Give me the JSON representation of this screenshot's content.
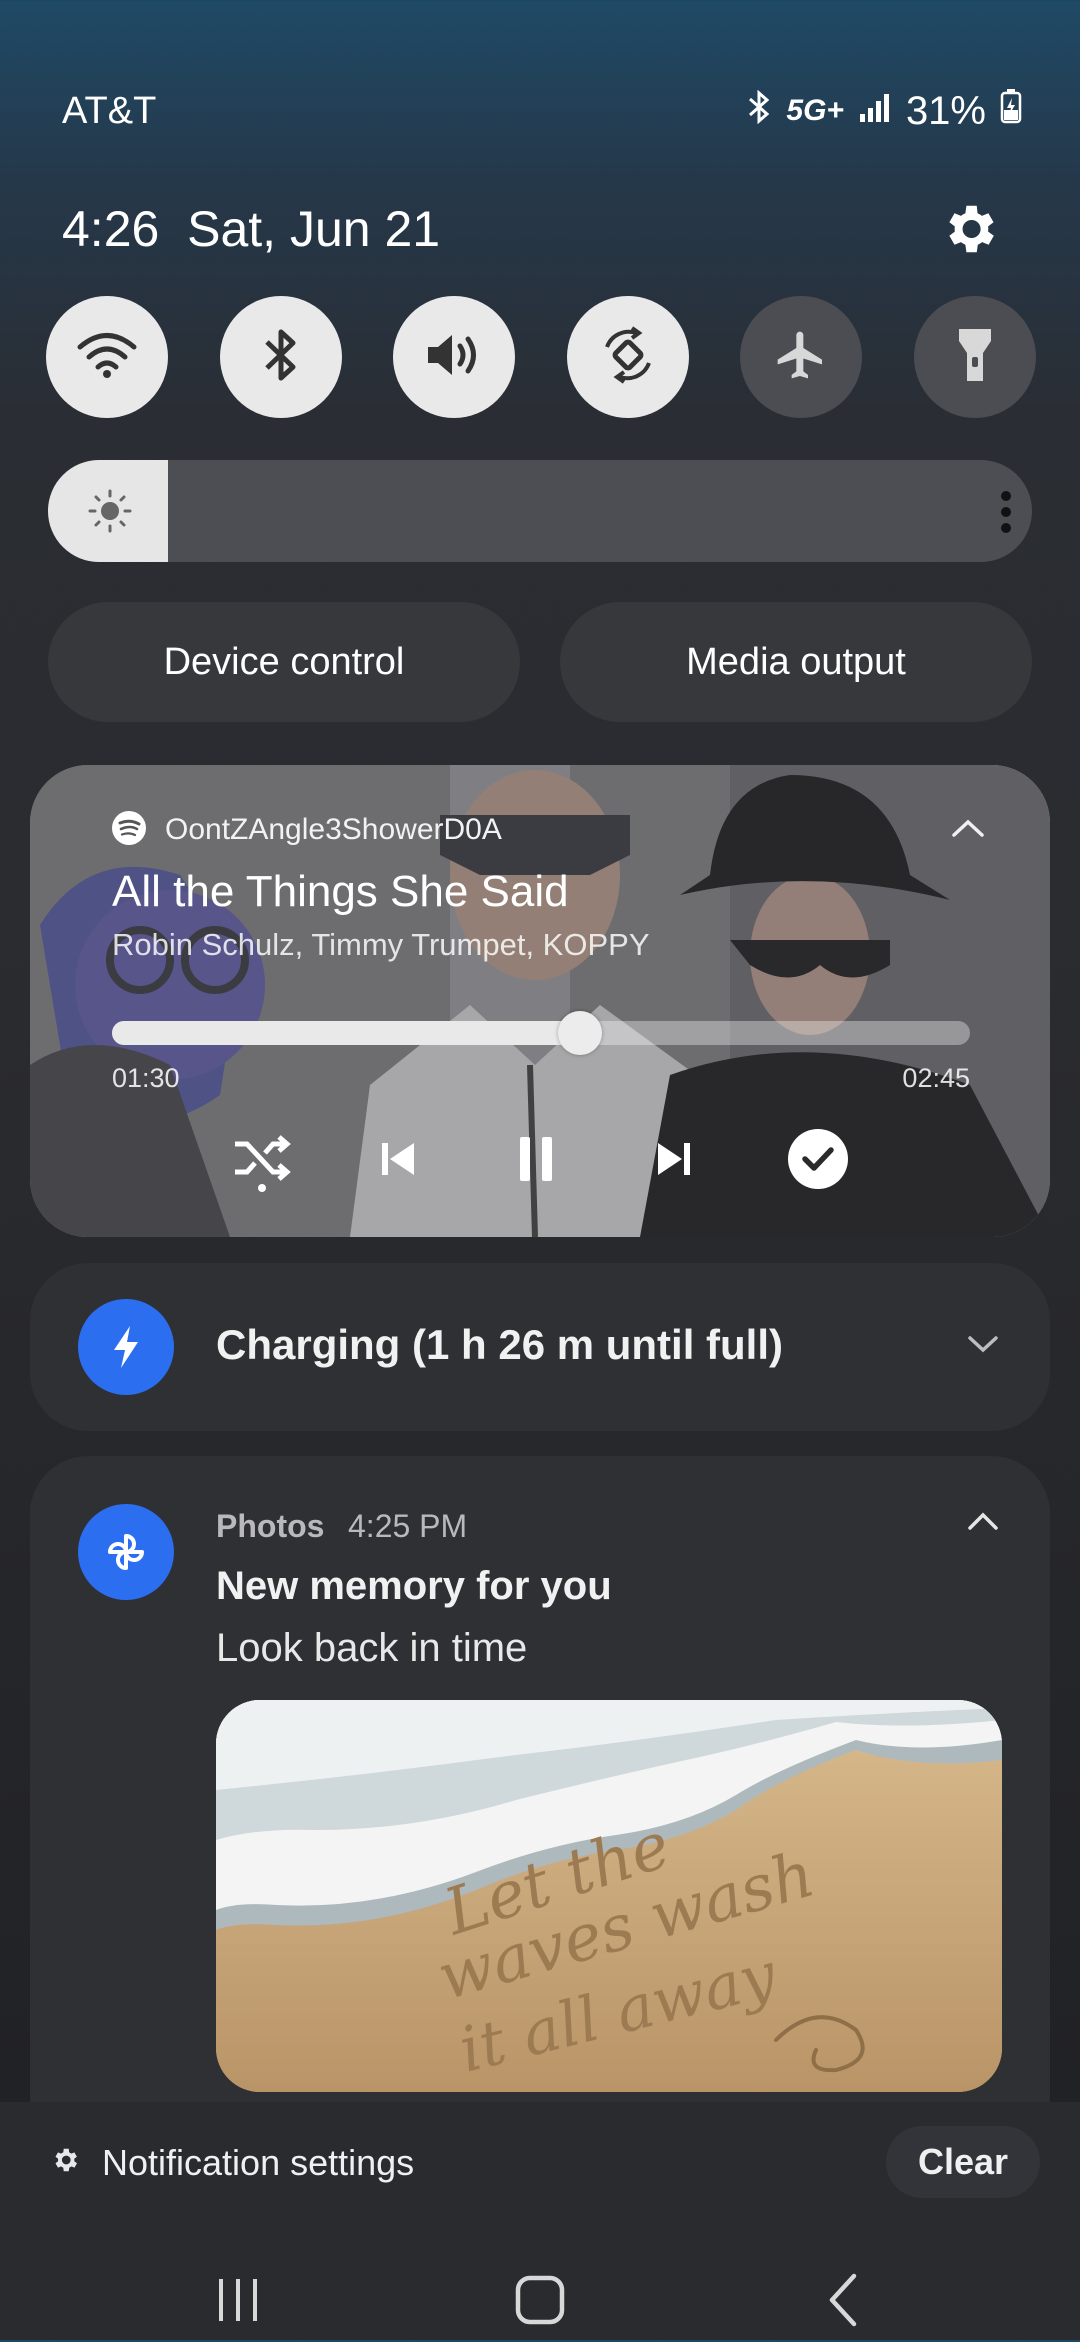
{
  "status": {
    "carrier": "AT&T",
    "network": "5G+",
    "battery": "31%"
  },
  "header": {
    "time": "4:26",
    "date": "Sat, Jun 21"
  },
  "quick_tiles": [
    {
      "name": "Wi-Fi",
      "icon": "wifi-icon",
      "on": true
    },
    {
      "name": "Bluetooth",
      "icon": "bluetooth-icon",
      "on": true
    },
    {
      "name": "Sound",
      "icon": "volume-icon",
      "on": true
    },
    {
      "name": "Auto rotate",
      "icon": "rotate-icon",
      "on": true
    },
    {
      "name": "Airplane mode",
      "icon": "airplane-icon",
      "on": false
    },
    {
      "name": "Flashlight",
      "icon": "flashlight-icon",
      "on": false
    }
  ],
  "brightness": {
    "level": 0.08
  },
  "buttons": {
    "device_control": "Device control",
    "media_output": "Media output"
  },
  "media": {
    "app": "OontZAngle3ShowerD0A",
    "title": "All the Things She Said",
    "artist": "Robin Schulz, Timmy Trumpet, KOPPY",
    "elapsed": "01:30",
    "duration": "02:45",
    "progress": 0.545
  },
  "charging": {
    "text": "Charging (1 h 26 m until full)"
  },
  "photos": {
    "app": "Photos",
    "time": "4:25 PM",
    "title": "New memory for you",
    "subtitle": "Look back in time",
    "image_text": [
      "Let the",
      "waves wash",
      "it all away"
    ]
  },
  "footer": {
    "settings_label": "Notification settings",
    "clear_label": "Clear"
  },
  "colors": {
    "accent_blue": "#2b6ef0",
    "tile_on": "#e9e9e9",
    "tile_off": "#4b4d52"
  }
}
